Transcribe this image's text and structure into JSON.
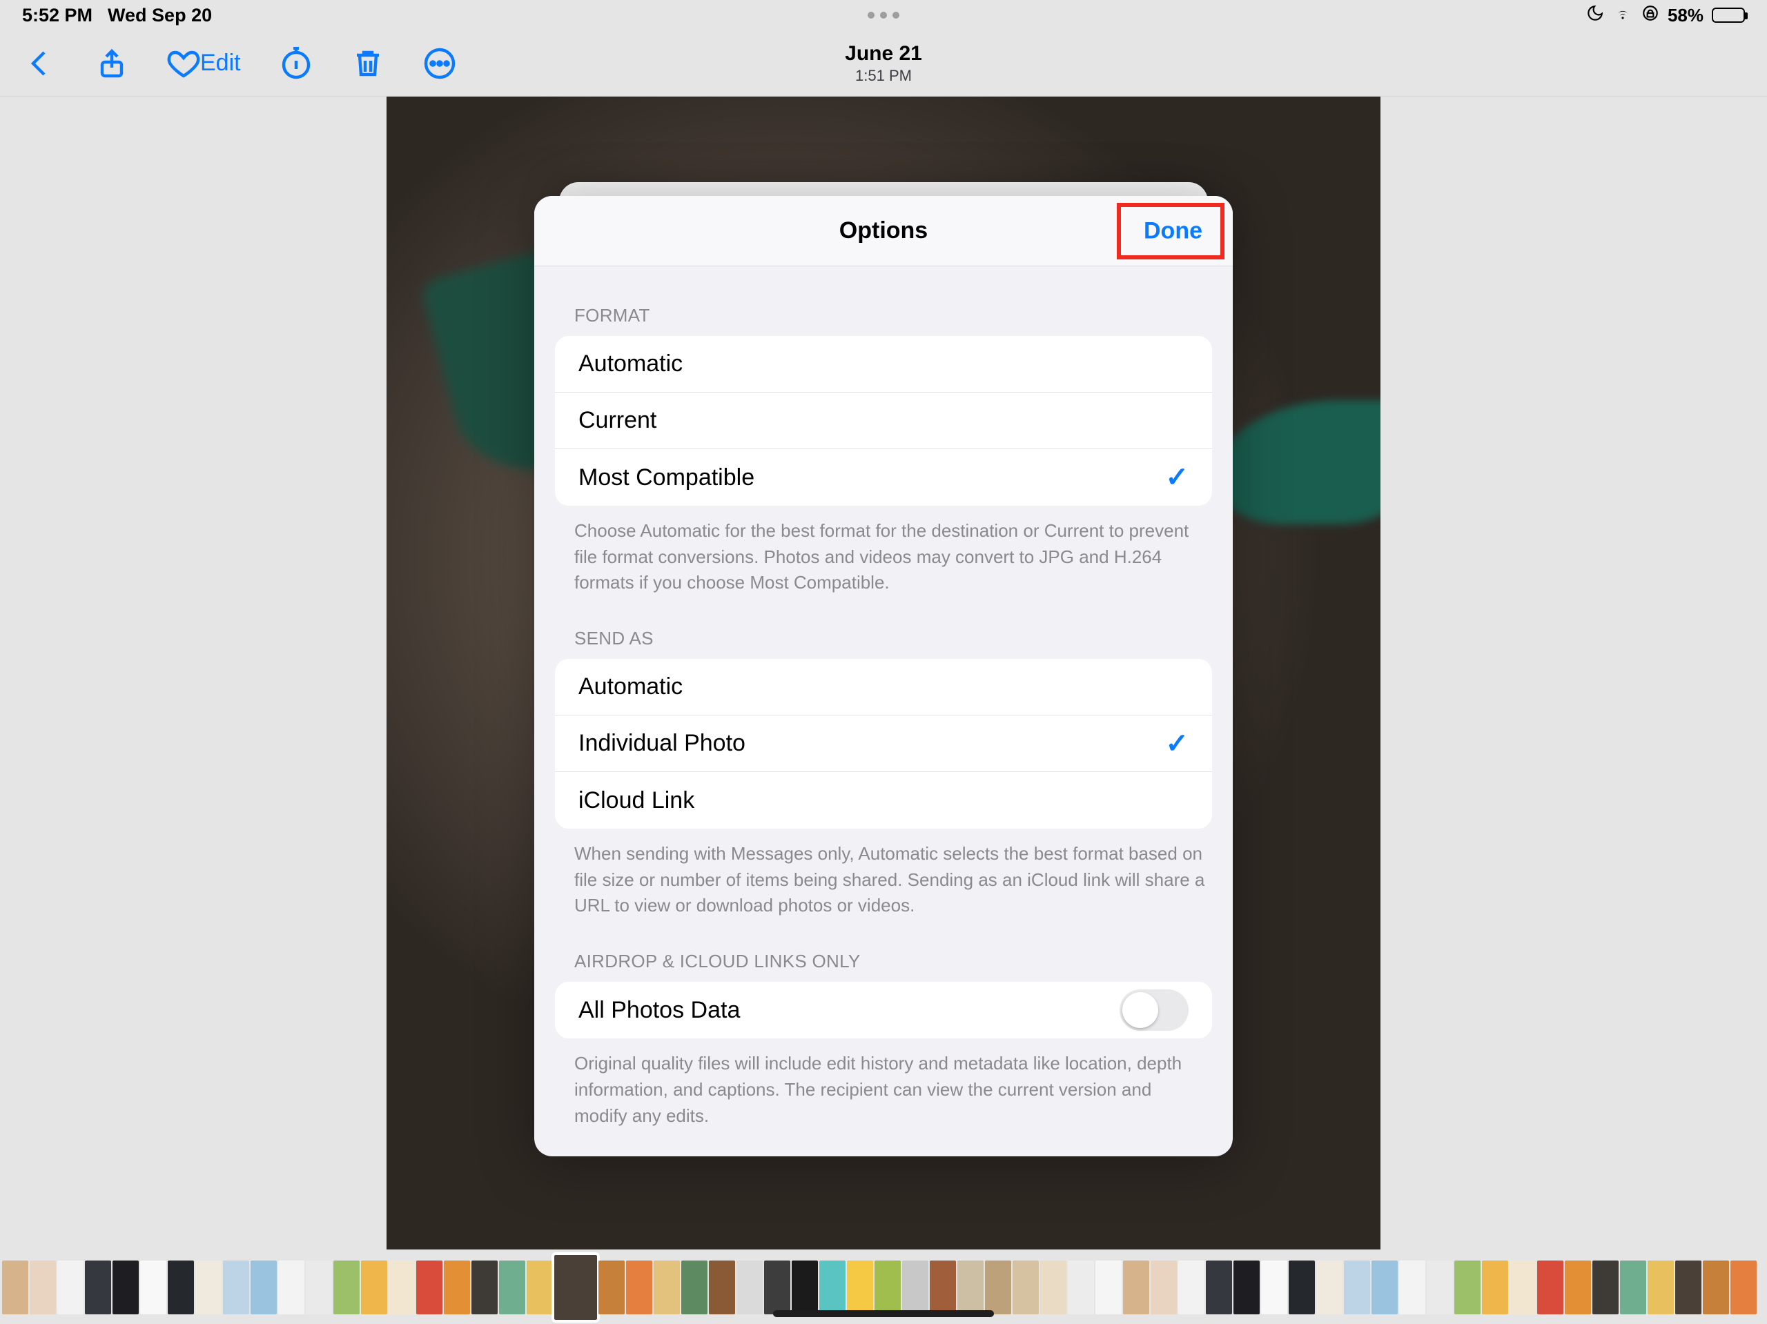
{
  "status": {
    "time": "5:52 PM",
    "date": "Wed Sep 20",
    "battery_pct": "58%"
  },
  "nav": {
    "photo_date": "June 21",
    "photo_time": "1:51 PM",
    "edit_label": "Edit"
  },
  "modal": {
    "title": "Options",
    "done_label": "Done",
    "sections": {
      "format": {
        "header": "FORMAT",
        "options": [
          "Automatic",
          "Current",
          "Most Compatible"
        ],
        "selected_index": 2,
        "footer": "Choose Automatic for the best format for the destination or Current to prevent file format conversions. Photos and videos may convert to JPG and H.264 formats if you choose Most Compatible."
      },
      "send_as": {
        "header": "SEND AS",
        "options": [
          "Automatic",
          "Individual Photo",
          "iCloud Link"
        ],
        "selected_index": 1,
        "footer": "When sending with Messages only, Automatic selects the best format based on file size or number of items being shared. Sending as an iCloud link will share a URL to view or download photos or videos."
      },
      "airdrop": {
        "header": "AIRDROP & ICLOUD LINKS ONLY",
        "label": "All Photos Data",
        "toggle_on": false,
        "footer": "Original quality files will include edit history and metadata like location, depth information, and captions. The recipient can view the current version and modify any edits."
      }
    }
  },
  "thumbs": {
    "count": 63,
    "selected_index": 20
  }
}
